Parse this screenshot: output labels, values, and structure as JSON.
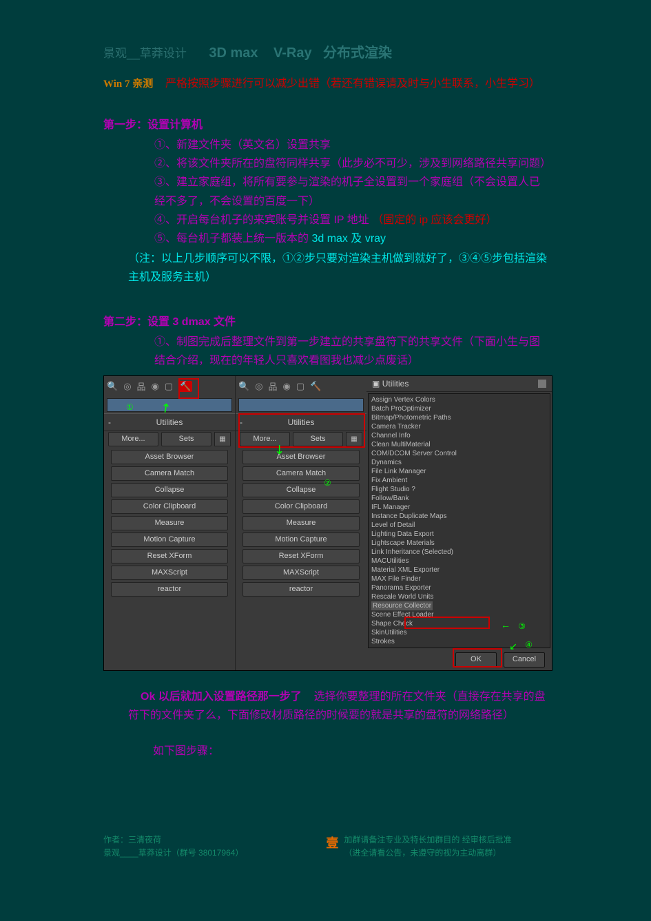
{
  "title": {
    "t1": "景观__草莽设计",
    "t2": "3D max",
    "t3": "V-Ray",
    "t4": "分布式渲染"
  },
  "win7_line": {
    "a": "Win 7  亲测",
    "b": "严格按照步骤进行可以减少出错（若还有错误请及时与小生联系，小生学习）"
  },
  "step1": {
    "h": "第一步：设置计算机",
    "li1": "①、新建文件夹（英文名）设置共享",
    "li2": "②、将该文件夹所在的盘符同样共享（此步必不可少，涉及到网络路径共享问题）",
    "li3": "③、建立家庭组，将所有要参与渲染的机子全设置到一个家庭组（不会设置人已经不多了，不会设置的百度一下）",
    "li4a": "④、开启每台机子的来宾账号并设置 IP 地址",
    "li4b": "（固定的 ip 应该会更好）",
    "li5a": "⑤、每台机子都装上统一版本的 ",
    "li5b": "3d max  及 vray",
    "note": "（注：以上几步顺序可以不限，①②步只要对渲染主机做到就好了，③④⑤步包括渲染主机及服务主机）"
  },
  "step2": {
    "h": "第二步：设置 3 dmax 文件",
    "li1": "①、制图完成后整理文件到第一步建立的共享盘符下的共享文件（下面小生与图结合介绍，现在的年轻人只喜欢看图我也减少点废话）"
  },
  "shot": {
    "section": "Utilities",
    "more": "More...",
    "sets": "Sets",
    "row_btns": [
      "Asset Browser",
      "Camera Match",
      "Collapse",
      "Color Clipboard",
      "Measure",
      "Motion Capture",
      "Reset XForm",
      "MAXScript",
      "reactor"
    ],
    "util_title": "Utilities",
    "util_list": [
      "Assign Vertex Colors",
      "Batch ProOptimizer",
      "Bitmap/Photometric Paths",
      "Camera Tracker",
      "Channel Info",
      "Clean MultiMaterial",
      "COM/DCOM Server Control",
      "Dynamics",
      "File Link Manager",
      "Fix Ambient",
      "Flight Studio ?",
      "Follow/Bank",
      "IFL Manager",
      "Instance Duplicate Maps",
      "Level of Detail",
      "Lighting Data Export",
      "Lightscape Materials",
      "Link Inheritance (Selected)",
      "MACUtilities",
      "Material XML Exporter",
      "MAX File Finder",
      "Panorama Exporter",
      "Rescale World Units",
      "Resource Collector",
      "Scene Effect Loader",
      "Shape Check",
      "SkinUtilities",
      "Strokes"
    ],
    "ok": "OK",
    "cancel": "Cancel",
    "marks": {
      "m1": "①",
      "m2": "②",
      "m3": "③",
      "m4": "④"
    }
  },
  "after": {
    "p1a": "Ok 以后就加入设置路径那一步了",
    "p1b": "选择你要整理的所在文件夹（直接存在共享的盘",
    "p2": "符下的文件夹了么，下面修改材质路径的时候要的就是共享的盘符的网络路径）",
    "p3": "如下图步骤："
  },
  "footer": {
    "author": "作者：三清夜荷",
    "group": "景观____草莽设计（群号 38017964）",
    "num": "壹",
    "r1": "加群请备注专业及特长加群目的  经审核后批准",
    "r2": "（进全请看公告，未遵守的视为主动离群）"
  }
}
